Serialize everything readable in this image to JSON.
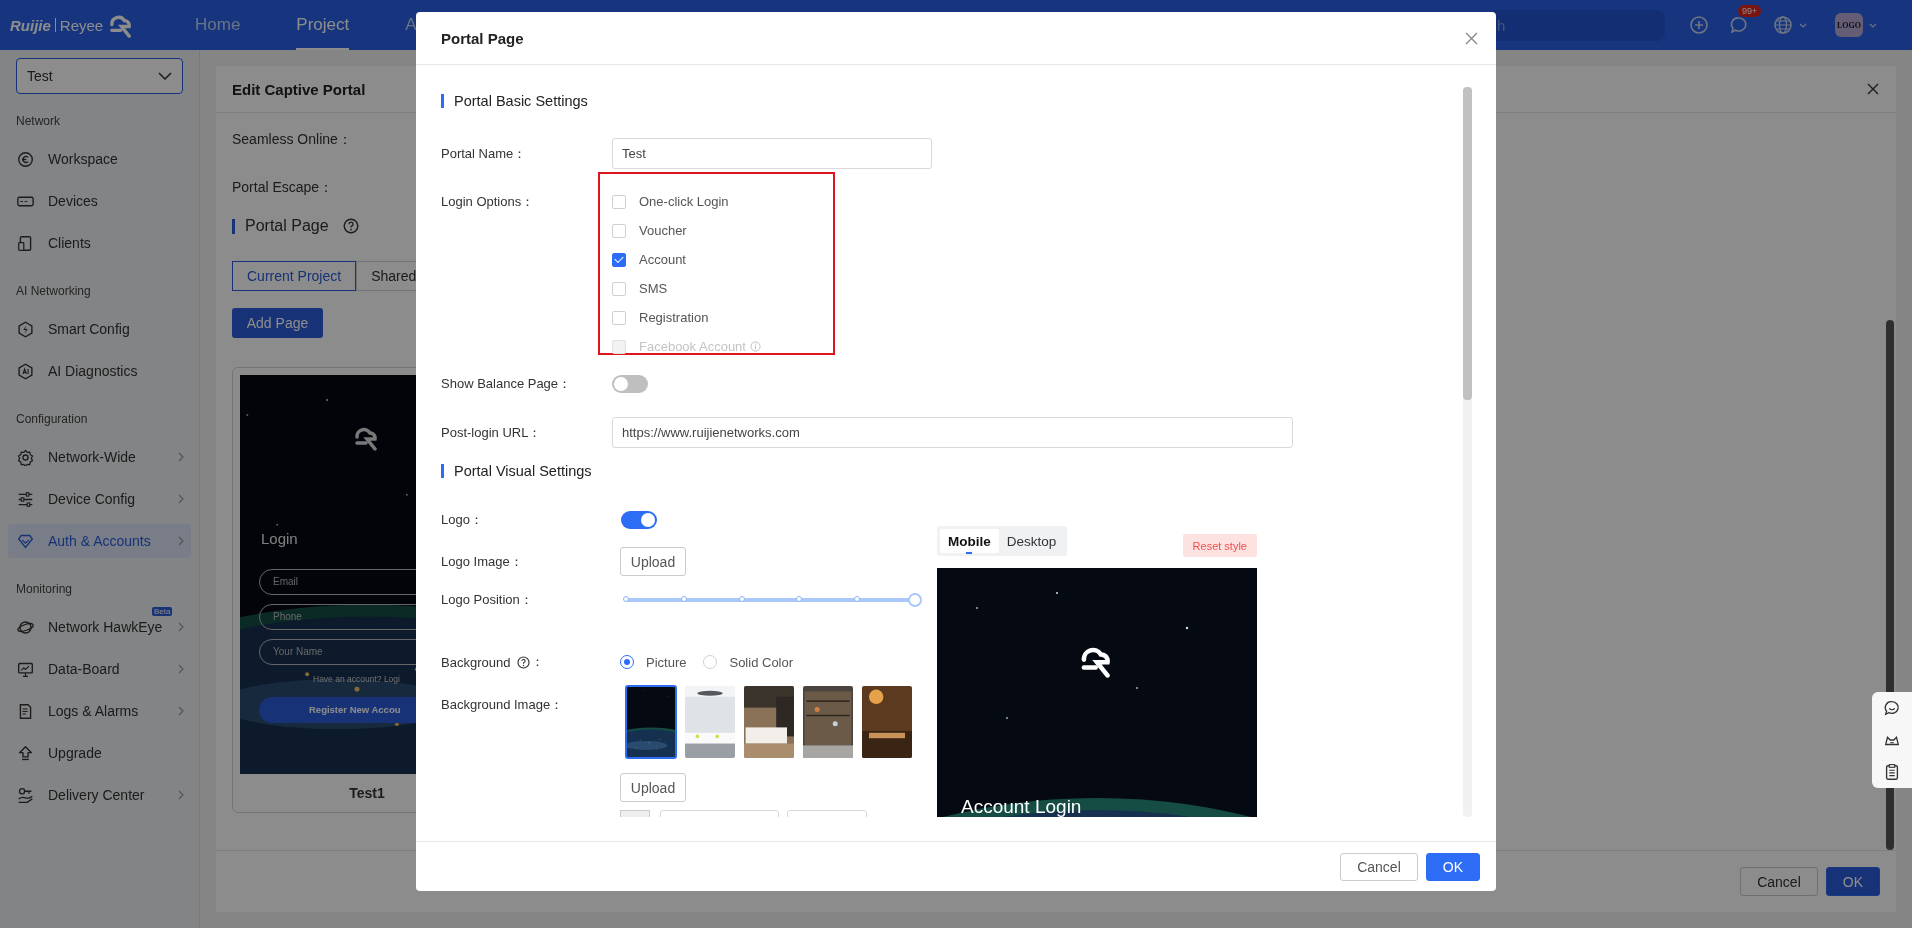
{
  "topbar": {
    "brand": [
      "Ruijie",
      "Reyee"
    ],
    "nav": [
      {
        "label": "Home",
        "selected": false
      },
      {
        "label": "Project",
        "selected": true
      },
      {
        "label": "A",
        "selected": false
      }
    ],
    "search": {
      "placeholder": "h"
    },
    "notifications": "99+",
    "avatar": "LOGO"
  },
  "sidebar": {
    "project": "Test",
    "groups": [
      {
        "title": "Network",
        "items": [
          {
            "label": "Workspace",
            "selected": false,
            "submenu": false
          },
          {
            "label": "Devices",
            "selected": false,
            "submenu": false
          },
          {
            "label": "Clients",
            "selected": false,
            "submenu": false
          }
        ]
      },
      {
        "title": "AI Networking",
        "items": [
          {
            "label": "Smart Config",
            "selected": false,
            "submenu": false
          },
          {
            "label": "AI Diagnostics",
            "selected": false,
            "submenu": false
          }
        ]
      },
      {
        "title": "Configuration",
        "items": [
          {
            "label": "Network-Wide",
            "selected": false,
            "submenu": true
          },
          {
            "label": "Device Config",
            "selected": false,
            "submenu": true
          },
          {
            "label": "Auth & Accounts",
            "selected": true,
            "submenu": true
          }
        ]
      },
      {
        "title": "Monitoring",
        "items": [
          {
            "label": "Network HawkEye",
            "selected": false,
            "submenu": true,
            "badge": "Beta"
          },
          {
            "label": "Data-Board",
            "selected": false,
            "submenu": true
          },
          {
            "label": "Logs & Alarms",
            "selected": false,
            "submenu": true
          },
          {
            "label": "Upgrade",
            "selected": false,
            "submenu": false
          },
          {
            "label": "Delivery Center",
            "selected": false,
            "submenu": true
          }
        ]
      }
    ]
  },
  "page": {
    "title": "Edit Captive Portal",
    "fields": [
      "Seamless Online：",
      "Portal Escape："
    ],
    "section": "Portal Page",
    "tabs": [
      {
        "label": "Current Project",
        "selected": true
      },
      {
        "label": "Shared",
        "selected": false
      }
    ],
    "add_button": "Add Page",
    "card": {
      "name": "Test1",
      "preview": {
        "title": "Login",
        "fields": [
          "Email",
          "Phone",
          "Your Name"
        ],
        "hint": "Have an account? Logi",
        "button": "Register New Accou"
      }
    },
    "buttons": [
      "Cancel",
      "OK"
    ]
  },
  "modal": {
    "title": "Portal Page",
    "basic": {
      "title": "Portal Basic Settings",
      "portal_name": {
        "label": "Portal Name：",
        "value": "Test"
      },
      "login_options": {
        "label": "Login Options：",
        "options": [
          {
            "label": "One-click Login",
            "checked": false,
            "disabled": false
          },
          {
            "label": "Voucher",
            "checked": false,
            "disabled": false
          },
          {
            "label": "Account",
            "checked": true,
            "disabled": false
          },
          {
            "label": "SMS",
            "checked": false,
            "disabled": false
          },
          {
            "label": "Registration",
            "checked": false,
            "disabled": false
          },
          {
            "label": "Facebook Account",
            "checked": false,
            "disabled": true
          }
        ]
      },
      "balance": {
        "label": "Show Balance Page：",
        "on": false
      },
      "url": {
        "label": "Post-login URL：",
        "value": "https://www.ruijienetworks.com"
      }
    },
    "visual": {
      "title": "Portal Visual Settings",
      "logo": {
        "label": "Logo：",
        "on": true
      },
      "logo_image": {
        "label": "Logo Image：",
        "button": "Upload"
      },
      "logo_position": {
        "label": "Logo Position：",
        "level": 1
      },
      "background": {
        "label": "Background",
        "colon": "：",
        "options": [
          {
            "label": "Picture",
            "selected": true
          },
          {
            "label": "Solid Color",
            "selected": false
          }
        ]
      },
      "background_image": {
        "label": "Background Image：",
        "images": [
          {
            "selected": true
          },
          {
            "selected": false
          },
          {
            "selected": false
          },
          {
            "selected": false
          },
          {
            "selected": false
          }
        ],
        "button": "Upload"
      },
      "preview": {
        "tabs": [
          {
            "label": "Mobile",
            "selected": true
          },
          {
            "label": "Desktop",
            "selected": false
          }
        ],
        "reset": "Reset style",
        "title": "Account Login"
      }
    },
    "buttons": [
      "Cancel",
      "OK"
    ]
  }
}
